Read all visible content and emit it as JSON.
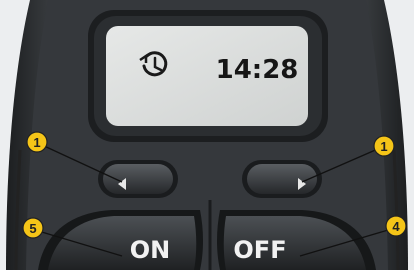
{
  "display": {
    "icon": "clock-timer-icon",
    "time": "14:28"
  },
  "buttons": {
    "left_arrow": {
      "icon": "arrow-left-icon"
    },
    "right_arrow": {
      "icon": "arrow-right-icon"
    },
    "on_label": "ON",
    "off_label": "OFF"
  },
  "callouts": {
    "left_arrow": "1",
    "right_arrow": "1",
    "on_button": "5",
    "off_button": "4"
  },
  "colors": {
    "callout_fill": "#f5c518",
    "device_body": "#3a3d40",
    "lcd_background": "#dcdedd"
  }
}
